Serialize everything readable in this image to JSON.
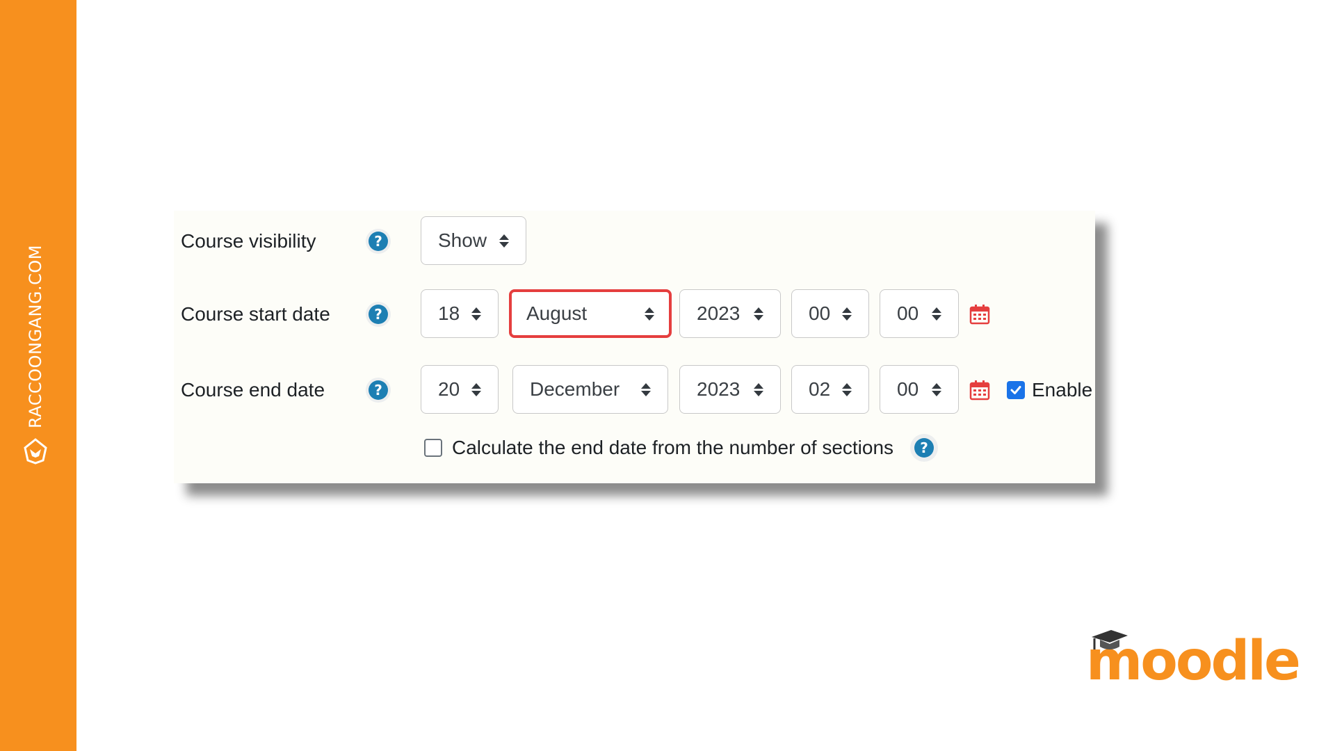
{
  "brand": {
    "site": "RACCOONGANG.COM",
    "color": "#f7901e"
  },
  "form": {
    "visibility": {
      "label": "Course visibility",
      "value": "Show"
    },
    "start_date": {
      "label": "Course start date",
      "day": "18",
      "month": "August",
      "year": "2023",
      "hour": "00",
      "minute": "00"
    },
    "end_date": {
      "label": "Course end date",
      "day": "20",
      "month": "December",
      "year": "2023",
      "hour": "02",
      "minute": "00",
      "enable_label": "Enable",
      "enabled": true
    },
    "calc_end": {
      "label": "Calculate the end date from the number of sections",
      "checked": false
    },
    "help_glyph": "?",
    "highlight_color": "#e53e3e",
    "help_color": "#1d7fb3",
    "calendar_color": "#e53e3e"
  },
  "logo": {
    "text": "moodle"
  }
}
